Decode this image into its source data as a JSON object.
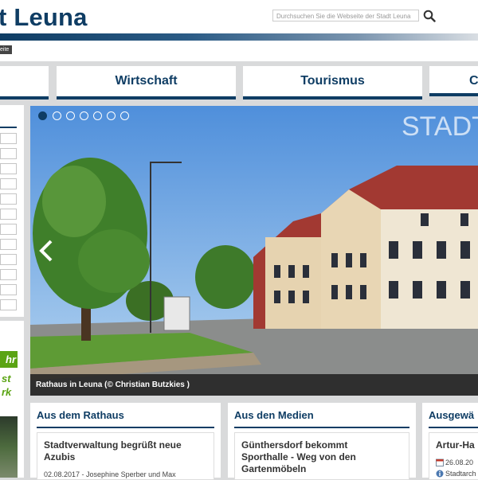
{
  "header": {
    "logo_text": "t Leuna",
    "search_placeholder": "Durchsuchen Sie die Webseite der Stadt Leuna",
    "breadcrumb": "eite"
  },
  "nav": {
    "items": [
      {
        "label": ""
      },
      {
        "label": "Wirtschaft"
      },
      {
        "label": "Tourismus"
      },
      {
        "label": "C"
      }
    ]
  },
  "slider": {
    "overlay_title": "STADT",
    "caption": "Rathaus in Leuna (© Christian Butzkies )",
    "dots_count": 7,
    "active_dot": 1
  },
  "sidebar": {
    "green_tag": "hr",
    "text_1": "st",
    "text_2": "rk"
  },
  "boxes": [
    {
      "title": "Aus dem Rathaus",
      "card_title": "Stadtverwaltung begrüßt neue Azubis",
      "card_meta": "02.08.2017 - Josephine Sperber und Max"
    },
    {
      "title": "Aus den Medien",
      "card_title": "Günthersdorf bekommt Sporthalle - Weg von den Gartenmöbeln",
      "card_meta": ""
    },
    {
      "title": "Ausgewä",
      "card_title": "Artur-Ha",
      "card_date": "26.08.20",
      "card_place": "Stadtarch"
    }
  ],
  "colors": {
    "brand": "#0f3d64",
    "accent_green": "#5ba414"
  }
}
